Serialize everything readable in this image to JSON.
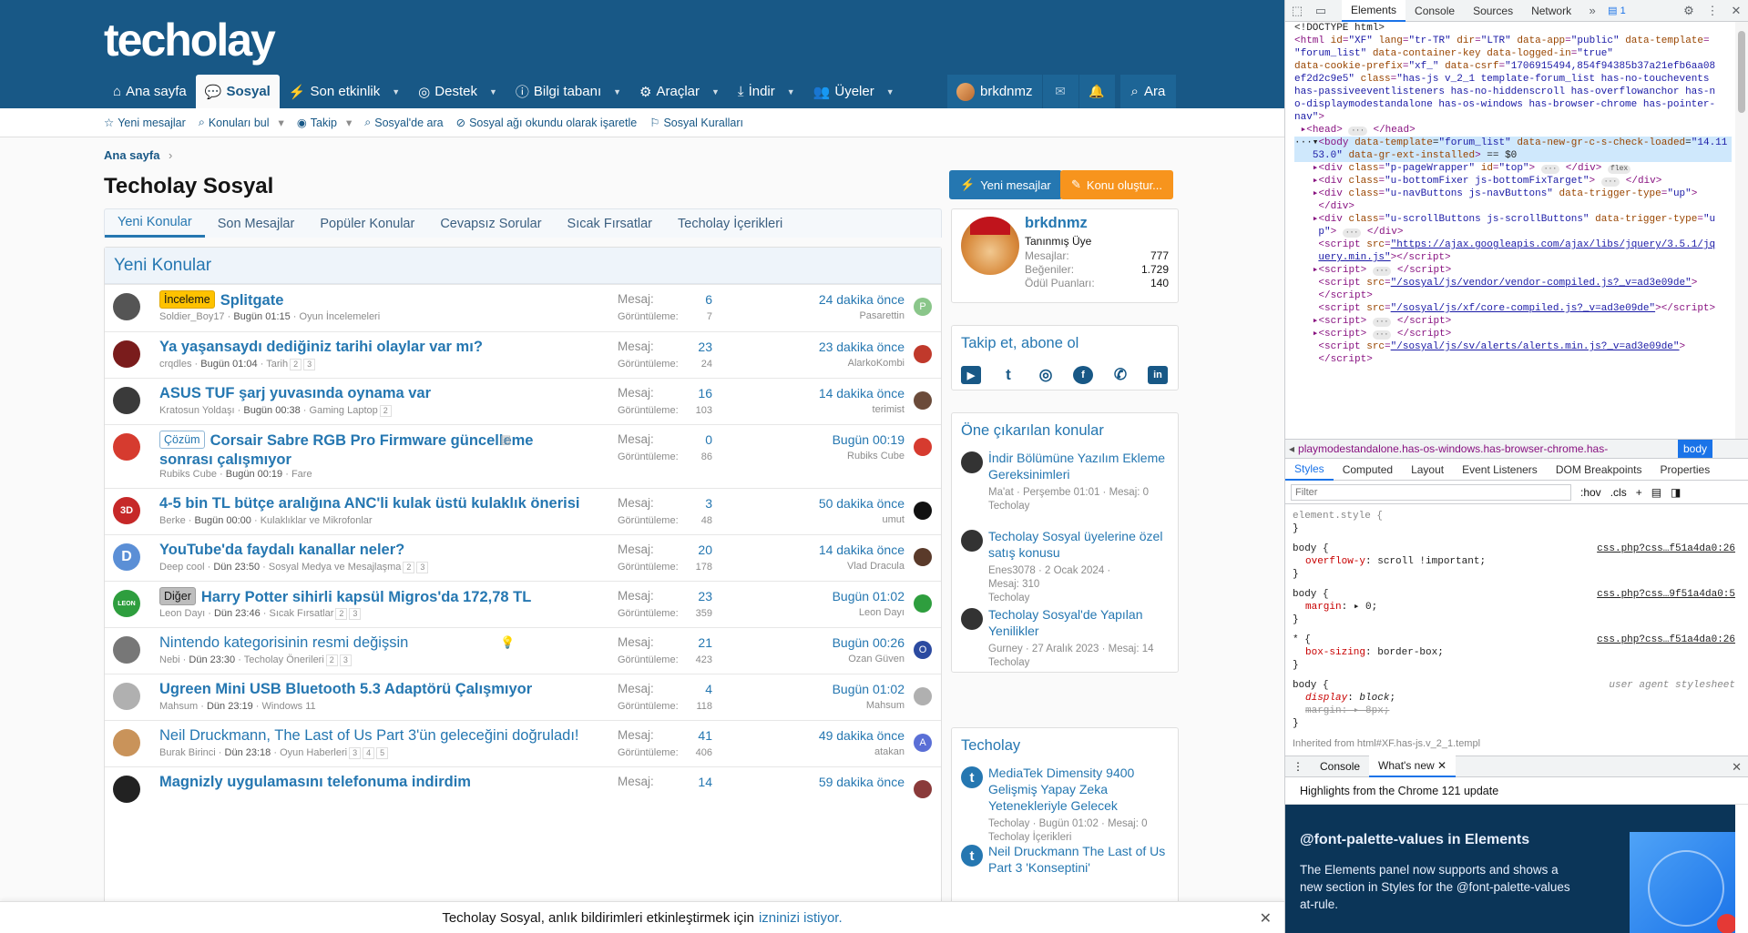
{
  "site": {
    "logo": "techolay",
    "nav": [
      {
        "icon": "⌂",
        "label": "Ana sayfa",
        "active": false,
        "dropdown": false
      },
      {
        "icon": "💬",
        "label": "Sosyal",
        "active": true,
        "dropdown": false
      },
      {
        "icon": "⚡",
        "label": "Son etkinlik",
        "active": false,
        "dropdown": true
      },
      {
        "icon": "◎",
        "label": "Destek",
        "active": false,
        "dropdown": true
      },
      {
        "icon": "ⓘ",
        "label": "Bilgi tabanı",
        "active": false,
        "dropdown": true
      },
      {
        "icon": "⚙",
        "label": "Araçlar",
        "active": false,
        "dropdown": true
      },
      {
        "icon": "⤓",
        "label": "İndir",
        "active": false,
        "dropdown": true
      },
      {
        "icon": "👥",
        "label": "Üyeler",
        "active": false,
        "dropdown": true
      }
    ],
    "account": {
      "username": "brkdnmz",
      "search_label": "Ara"
    },
    "subnav": [
      {
        "icon": "☆",
        "label": "Yeni mesajlar"
      },
      {
        "icon": "⌕",
        "label": "Konuları bul"
      },
      {
        "icon": "◉",
        "label": "Takip"
      },
      {
        "icon": "⌕",
        "label": "Sosyal'de ara"
      },
      {
        "icon": "⊘",
        "label": "Sosyal ağı okundu olarak işaretle"
      },
      {
        "icon": "⚐",
        "label": "Sosyal Kuralları"
      }
    ],
    "breadcrumb": "Ana sayfa",
    "page_title": "Techolay Sosyal",
    "btn_new": "Yeni mesajlar",
    "btn_create": "Konu oluştur...",
    "tabs": [
      "Yeni Konular",
      "Son Mesajlar",
      "Popüler Konular",
      "Cevapsız Sorular",
      "Sıcak Fırsatlar",
      "Techolay İçerikleri"
    ],
    "block_title": "Yeni Konular",
    "stat_labels": {
      "replies": "Mesaj:",
      "views": "Görüntüleme:"
    },
    "threads": [
      {
        "prefix": "İnceleme",
        "prefix_style": "yellow",
        "title": "Splitgate",
        "bold": true,
        "author": "Soldier_Boy17",
        "date": "Bugün 01:15",
        "forum": "Oyun İncelemeleri",
        "pages": [],
        "replies": "6",
        "views": "7",
        "last_time": "24 dakika önce",
        "last_user": "Pasarettin",
        "avatar_letter": "",
        "avatar_color": "#555555",
        "last_letter": "P",
        "last_color": "#8ac68a",
        "icon": ""
      },
      {
        "prefix": "",
        "prefix_style": "",
        "title": "Ya yaşansaydı dediğiniz tarihi olaylar var mı?",
        "bold": true,
        "author": "crqdles",
        "date": "Bugün 01:04",
        "forum": "Tarih",
        "pages": [
          "2",
          "3"
        ],
        "replies": "23",
        "views": "24",
        "last_time": "23 dakika önce",
        "last_user": "AlarkoKombi",
        "avatar_letter": "",
        "avatar_color": "#7a1c1c",
        "last_letter": "",
        "last_color": "#c0392b",
        "icon": ""
      },
      {
        "prefix": "",
        "prefix_style": "",
        "title": "ASUS TUF şarj yuvasında oynama var",
        "bold": true,
        "author": "Kratosun Yoldaşı",
        "date": "Bugün 00:38",
        "forum": "Gaming Laptop",
        "pages": [
          "2"
        ],
        "replies": "16",
        "views": "103",
        "last_time": "14 dakika önce",
        "last_user": "terimist",
        "avatar_letter": "",
        "avatar_color": "#3a3a3a",
        "last_letter": "",
        "last_color": "#6b4b3a",
        "icon": ""
      },
      {
        "prefix": "Çözüm",
        "prefix_style": "blue",
        "title": "Corsair Sabre RGB Pro Firmware güncelleme sonrası çalışmıyor",
        "bold": true,
        "author": "Rubiks Cube",
        "date": "Bugün 00:19",
        "forum": "Fare",
        "pages": [],
        "replies": "0",
        "views": "86",
        "last_time": "Bugün 00:19",
        "last_user": "Rubiks Cube",
        "avatar_letter": "",
        "avatar_color": "#d63b2f",
        "last_letter": "",
        "last_color": "#d63b2f",
        "icon": "▤"
      },
      {
        "prefix": "",
        "prefix_style": "",
        "title": "4-5 bin TL bütçe aralığına ANC'li kulak üstü kulaklık önerisi",
        "bold": true,
        "author": "Berke",
        "date": "Bugün 00:00",
        "forum": "Kulaklıklar ve Mikrofonlar",
        "pages": [],
        "replies": "3",
        "views": "48",
        "last_time": "50 dakika önce",
        "last_user": "umut",
        "avatar_letter": "3D",
        "avatar_color": "#c62828",
        "last_letter": "",
        "last_color": "#111111",
        "icon": ""
      },
      {
        "prefix": "",
        "prefix_style": "",
        "title": "YouTube'da faydalı kanallar neler?",
        "bold": true,
        "author": "Deep cool",
        "date": "Dün 23:50",
        "forum": "Sosyal Medya ve Mesajlaşma",
        "pages": [
          "2",
          "3"
        ],
        "replies": "20",
        "views": "178",
        "last_time": "14 dakika önce",
        "last_user": "Vlad Dracula",
        "avatar_letter": "D",
        "avatar_color": "#5b8fd6",
        "last_letter": "",
        "last_color": "#5a3a2a",
        "icon": ""
      },
      {
        "prefix": "Diğer",
        "prefix_style": "gray",
        "title": "Harry Potter sihirli kapsül Migros'da 172,78 TL",
        "bold": true,
        "author": "Leon Dayı",
        "date": "Dün 23:46",
        "forum": "Sıcak Fırsatlar",
        "pages": [
          "2",
          "3"
        ],
        "replies": "23",
        "views": "359",
        "last_time": "Bugün 01:02",
        "last_user": "Leon Dayı",
        "avatar_letter": "LEON",
        "avatar_color": "#2e9e3e",
        "last_letter": "",
        "last_color": "#2e9e3e",
        "icon": ""
      },
      {
        "prefix": "",
        "prefix_style": "",
        "title": "Nintendo kategorisinin resmi değişsin",
        "bold": false,
        "author": "Nebi",
        "date": "Dün 23:30",
        "forum": "Techolay Önerileri",
        "pages": [
          "2",
          "3"
        ],
        "replies": "21",
        "views": "423",
        "last_time": "Bugün 00:26",
        "last_user": "Ozan Güven",
        "avatar_letter": "",
        "avatar_color": "#777777",
        "last_letter": "O",
        "last_color": "#2b4aa0",
        "icon": "💡"
      },
      {
        "prefix": "",
        "prefix_style": "",
        "title": "Ugreen Mini USB Bluetooth 5.3 Adaptörü Çalışmıyor",
        "bold": true,
        "author": "Mahsum",
        "date": "Dün 23:19",
        "forum": "Windows 11",
        "pages": [],
        "replies": "4",
        "views": "118",
        "last_time": "Bugün 01:02",
        "last_user": "Mahsum",
        "avatar_letter": "",
        "avatar_color": "#b0b0b0",
        "last_letter": "",
        "last_color": "#b0b0b0",
        "icon": ""
      },
      {
        "prefix": "",
        "prefix_style": "",
        "title": "Neil Druckmann, The Last of Us Part 3'ün geleceğini doğruladı!",
        "bold": false,
        "author": "Burak Birinci",
        "date": "Dün 23:18",
        "forum": "Oyun Haberleri",
        "pages": [
          "3",
          "4",
          "5"
        ],
        "replies": "41",
        "views": "406",
        "last_time": "49 dakika önce",
        "last_user": "atakan",
        "avatar_letter": "",
        "avatar_color": "#c9935a",
        "last_letter": "A",
        "last_color": "#5a6fd6",
        "icon": ""
      },
      {
        "prefix": "",
        "prefix_style": "",
        "title": "Magnizly uygulamasını telefonuma indirdim",
        "bold": true,
        "author": "",
        "date": "",
        "forum": "",
        "pages": [],
        "replies": "14",
        "views": "",
        "last_time": "59 dakika önce",
        "last_user": "",
        "avatar_letter": "",
        "avatar_color": "#222222",
        "last_letter": "",
        "last_color": "#8a3a3a",
        "icon": ""
      }
    ],
    "user_card": {
      "name": "brkdnmz",
      "role": "Tanınmış Üye",
      "stats": [
        {
          "label": "Mesajlar:",
          "value": "777"
        },
        {
          "label": "Beğeniler:",
          "value": "1.729"
        },
        {
          "label": "Ödül Puanları:",
          "value": "140"
        }
      ]
    },
    "social_title": "Takip et, abone ol",
    "social_icons": [
      "youtube-icon",
      "twitter-icon",
      "instagram-icon",
      "facebook-icon",
      "whatsapp-icon",
      "linkedin-icon"
    ],
    "featured_title": "Öne çıkarılan konular",
    "featured": [
      {
        "title": "İndir Bölümüne Yazılım Ekleme Gereksinimleri",
        "meta": "Ma'at · Perşembe 01:01 · Mesaj: 0",
        "forum": "Techolay"
      },
      {
        "title": "Techolay Sosyal üyelerine özel satış konusu",
        "meta": "Enes3078 · 2 Ocak 2024 · Mesaj: 310",
        "forum": "Techolay"
      },
      {
        "title": "Techolay Sosyal'de Yapılan Yenilikler",
        "meta": "Gurney · 27 Aralık 2023 · Mesaj: 14",
        "forum": "Techolay"
      }
    ],
    "tech_title": "Techolay",
    "tech_items": [
      {
        "title": "MediaTek Dimensity 9400 Gelişmiş Yapay Zeka Yetenekleriyle Gelecek",
        "meta": "Techolay · Bugün 01:02 · Mesaj: 0",
        "forum": "Techolay İçerikleri"
      },
      {
        "title": "Neil Druckmann The Last of Us Part 3 'Konseptini'",
        "meta": "",
        "forum": ""
      }
    ],
    "notice": {
      "text": "Techolay Sosyal, anlık bildirimleri etkinleştirmek için",
      "link": "izninizi istiyor."
    }
  },
  "devtools": {
    "tabs": [
      "Elements",
      "Console",
      "Sources",
      "Network"
    ],
    "badge": "1",
    "breadcrumb_path": "playmodestandalone.has-os-windows.has-browser-chrome.has-pointer-nav",
    "breadcrumb_selected": "body",
    "sub_tabs": [
      "Styles",
      "Computed",
      "Layout",
      "Event Listeners",
      "DOM Breakpoints",
      "Properties"
    ],
    "filter_placeholder": "Filter",
    "filter_tools": [
      ":hov",
      ".cls"
    ],
    "drawer_tabs": [
      "Console",
      "What's new"
    ],
    "highlights": "Highlights from the Chrome 121 update",
    "whatsnew_title": "@font-palette-values in Elements",
    "whatsnew_text": "The Elements panel now supports and shows a new section in Styles for the @font-palette-values at-rule.",
    "inherited": "Inherited from html#XF.has-js.v_2_1.templ"
  }
}
